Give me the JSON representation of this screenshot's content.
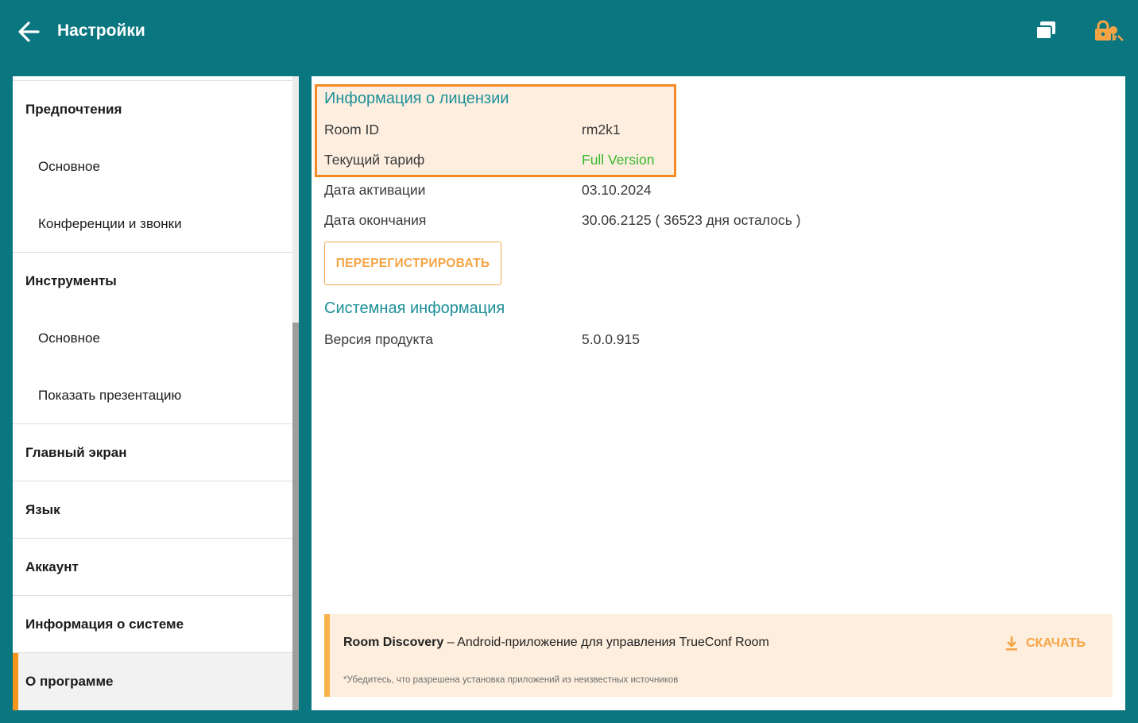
{
  "header": {
    "title": "Настройки",
    "icons": {
      "back": "arrow-left-icon",
      "windows": "windows-icon",
      "lock": "lock-key-icon"
    }
  },
  "sidebar": {
    "groups": [
      {
        "label": "Предпочтения",
        "items": [
          {
            "label": "Основное"
          },
          {
            "label": "Конференции и звонки"
          }
        ]
      },
      {
        "label": "Инструменты",
        "items": [
          {
            "label": "Основное"
          },
          {
            "label": "Показать презентацию"
          }
        ]
      },
      {
        "label": "Главный экран"
      },
      {
        "label": "Язык"
      },
      {
        "label": "Аккаунт"
      },
      {
        "label": "Информация о системе"
      },
      {
        "label": "О программе",
        "active": true
      }
    ]
  },
  "license": {
    "title": "Информация о лицензии",
    "rows": [
      {
        "label": "Room ID",
        "value": "rm2k1"
      },
      {
        "label": "Текущий тариф",
        "value": "Full Version"
      },
      {
        "label": "Дата активации",
        "value": "03.10.2024"
      },
      {
        "label": "Дата окончания",
        "value": "30.06.2125 ( 36523 дня осталось )"
      }
    ],
    "reregister_label": "ПЕРЕРЕГИСТРИРОВАТЬ"
  },
  "system": {
    "title": "Системная информация",
    "rows": [
      {
        "label": "Версия продукта",
        "value": "5.0.0.915"
      }
    ]
  },
  "banner": {
    "app_name": "Room Discovery",
    "description": " – Android-приложение для управления TrueConf Room",
    "note": "*Убедитесь, что разрешена установка приложений из неизвестных источников",
    "download_label": "СКАЧАТЬ",
    "download_icon": "download-icon"
  },
  "colors": {
    "header_bg": "#0a7680",
    "accent_orange": "#f7941d",
    "section_teal": "#1d9098",
    "status_green": "#38b82c",
    "button_orange": "#f5a445"
  }
}
